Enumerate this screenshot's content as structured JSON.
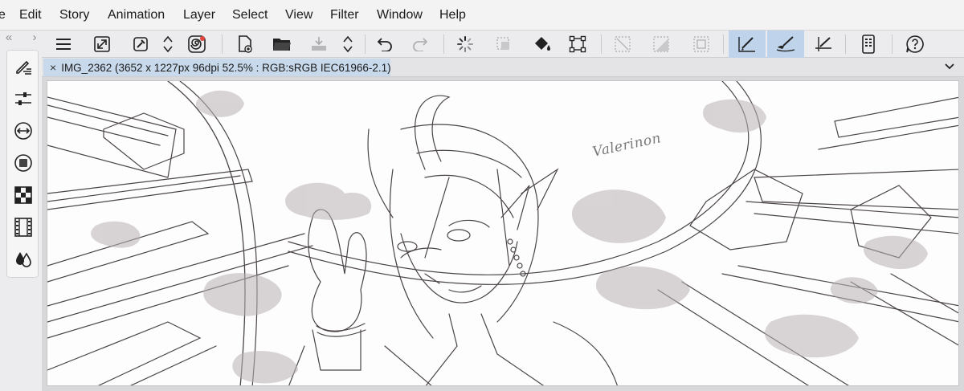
{
  "menubar": {
    "items": [
      {
        "label": "e"
      },
      {
        "label": "Edit"
      },
      {
        "label": "Story"
      },
      {
        "label": "Animation"
      },
      {
        "label": "Layer"
      },
      {
        "label": "Select"
      },
      {
        "label": "View"
      },
      {
        "label": "Filter"
      },
      {
        "label": "Window"
      },
      {
        "label": "Help"
      }
    ]
  },
  "toolbar": {
    "nav_left": "«",
    "nav_right": "›",
    "icons": [
      "menu-icon",
      "resize-canvas-icon",
      "eyedropper-icon",
      "stepper-icon",
      "spiral-icon",
      "new-file-icon",
      "open-folder-icon",
      "save-icon",
      "stepper-icon",
      "undo-icon",
      "redo-icon",
      "loading-spinner-icon",
      "deselect-icon",
      "fill-bucket-icon",
      "transform-icon",
      "selection-clear-icon",
      "selection-fill-icon",
      "selection-outline-icon",
      "pen-stabilizer-icon",
      "brush-icon",
      "ruler-snap-icon",
      "mobile-icon",
      "help-icon"
    ]
  },
  "document": {
    "close_glyph": "×",
    "title": "IMG_2362 (3652 x 1227px 96dpi 52.5% : RGB:sRGB IEC61966-2.1)"
  },
  "left_palette": {
    "icons": [
      "tool-property-icon",
      "adjust-sliders-icon",
      "navigator-icon",
      "layer-icon",
      "color-grid-icon",
      "timeline-film-icon",
      "color-drops-icon"
    ]
  },
  "canvas": {
    "signature": "Valerinon"
  },
  "colors": {
    "accent_active": "#bfd4ea",
    "tab_active": "#c8d9ec",
    "canvas_bg": "#fdfdfd",
    "sketch_line": "#4a4448"
  }
}
